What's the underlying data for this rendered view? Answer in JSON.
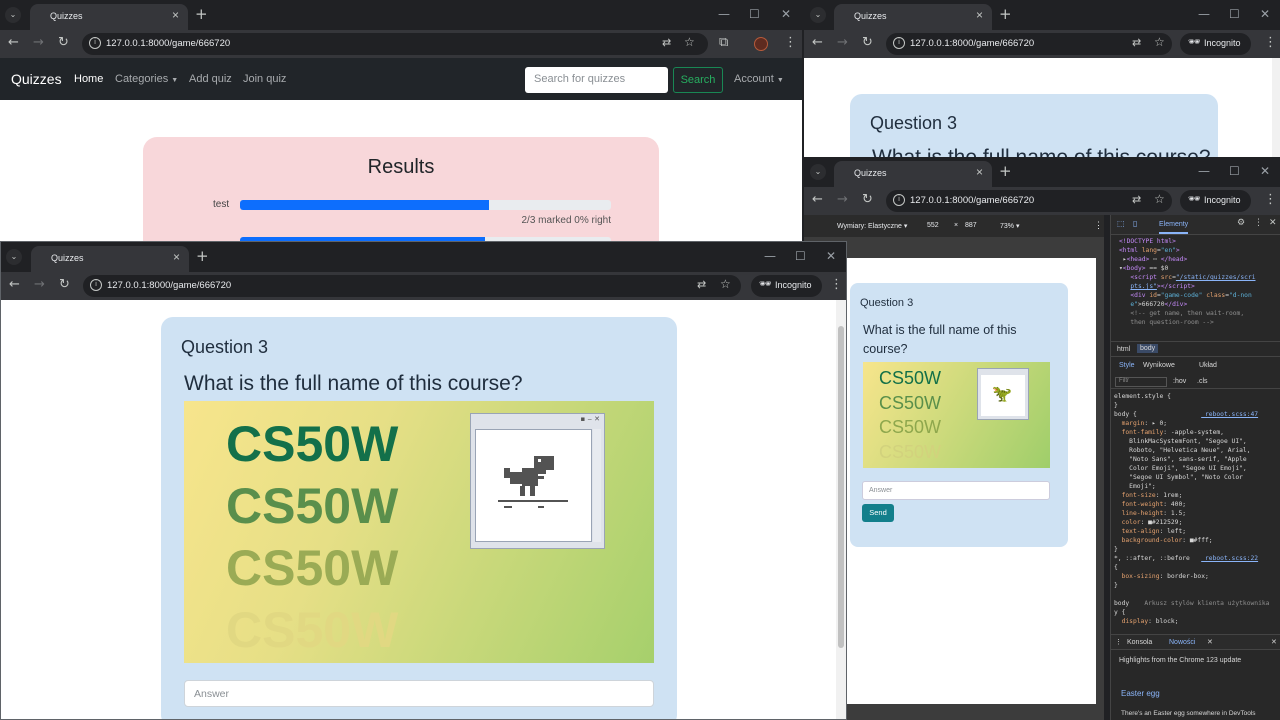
{
  "window_main": {
    "tab_title": "Quizzes",
    "url": "127.0.0.1:8000/game/666720",
    "navbar": {
      "brand": "Quizzes",
      "links": [
        "Home",
        "Categories",
        "Add quiz",
        "Join quiz"
      ],
      "search_placeholder": "Search for quizzes",
      "search_button": "Search",
      "account": "Account"
    },
    "results": {
      "title": "Results",
      "rows": [
        {
          "name": "test",
          "progress": 0.67,
          "caption": "2/3 marked 0% right"
        }
      ]
    }
  },
  "window_right_top": {
    "tab_title": "Quizzes",
    "url": "127.0.0.1:8000/game/666720",
    "incognito": "Incognito",
    "question_label": "Question 3",
    "question_text": "What is the full name of this course?"
  },
  "window_front": {
    "tab_title": "Quizzes",
    "url": "127.0.0.1:8000/game/666720",
    "incognito": "Incognito",
    "question_label": "Question 3",
    "question_text": "What is the full name of this course?",
    "image_words": [
      "CS50W",
      "CS50W",
      "CS50W",
      "CS50W"
    ],
    "answer_placeholder": "Answer"
  },
  "window_devtools": {
    "tab_title": "Quizzes",
    "url": "127.0.0.1:8000/game/666720",
    "incognito": "Incognito",
    "device_toolbar": {
      "dimensions_label": "Wymiary: Elastyczne",
      "width": "552",
      "x": "×",
      "height": "887",
      "zoom": "73%"
    },
    "page": {
      "question_label": "Question 3",
      "question_text": "What is the full name of this course?",
      "answer_placeholder": "Answer",
      "send_button": "Send"
    },
    "panel": {
      "elements_tab": "Elementy",
      "breadcrumb": [
        "html",
        "body"
      ],
      "subtabs": [
        "Style",
        "Wynikowe",
        "Układ"
      ],
      "filter_placeholder": "Filtr",
      "filter_controls": [
        ":hov",
        ".cls"
      ],
      "console_tabs": [
        "Konsola",
        "Nowości"
      ],
      "whats_new_heading": "Highlights from the Chrome 123 update",
      "easter_egg_title": "Easter egg",
      "easter_egg_text": "There's an Easter egg somewhere in DevTools"
    }
  },
  "colors": {
    "navbar_bg": "#212529",
    "results_bg": "#f8d7da",
    "question_bg": "#cfe2f3",
    "progress": "#0d6efd",
    "send_button": "#127f8b",
    "chrome_dark": "#202124"
  }
}
